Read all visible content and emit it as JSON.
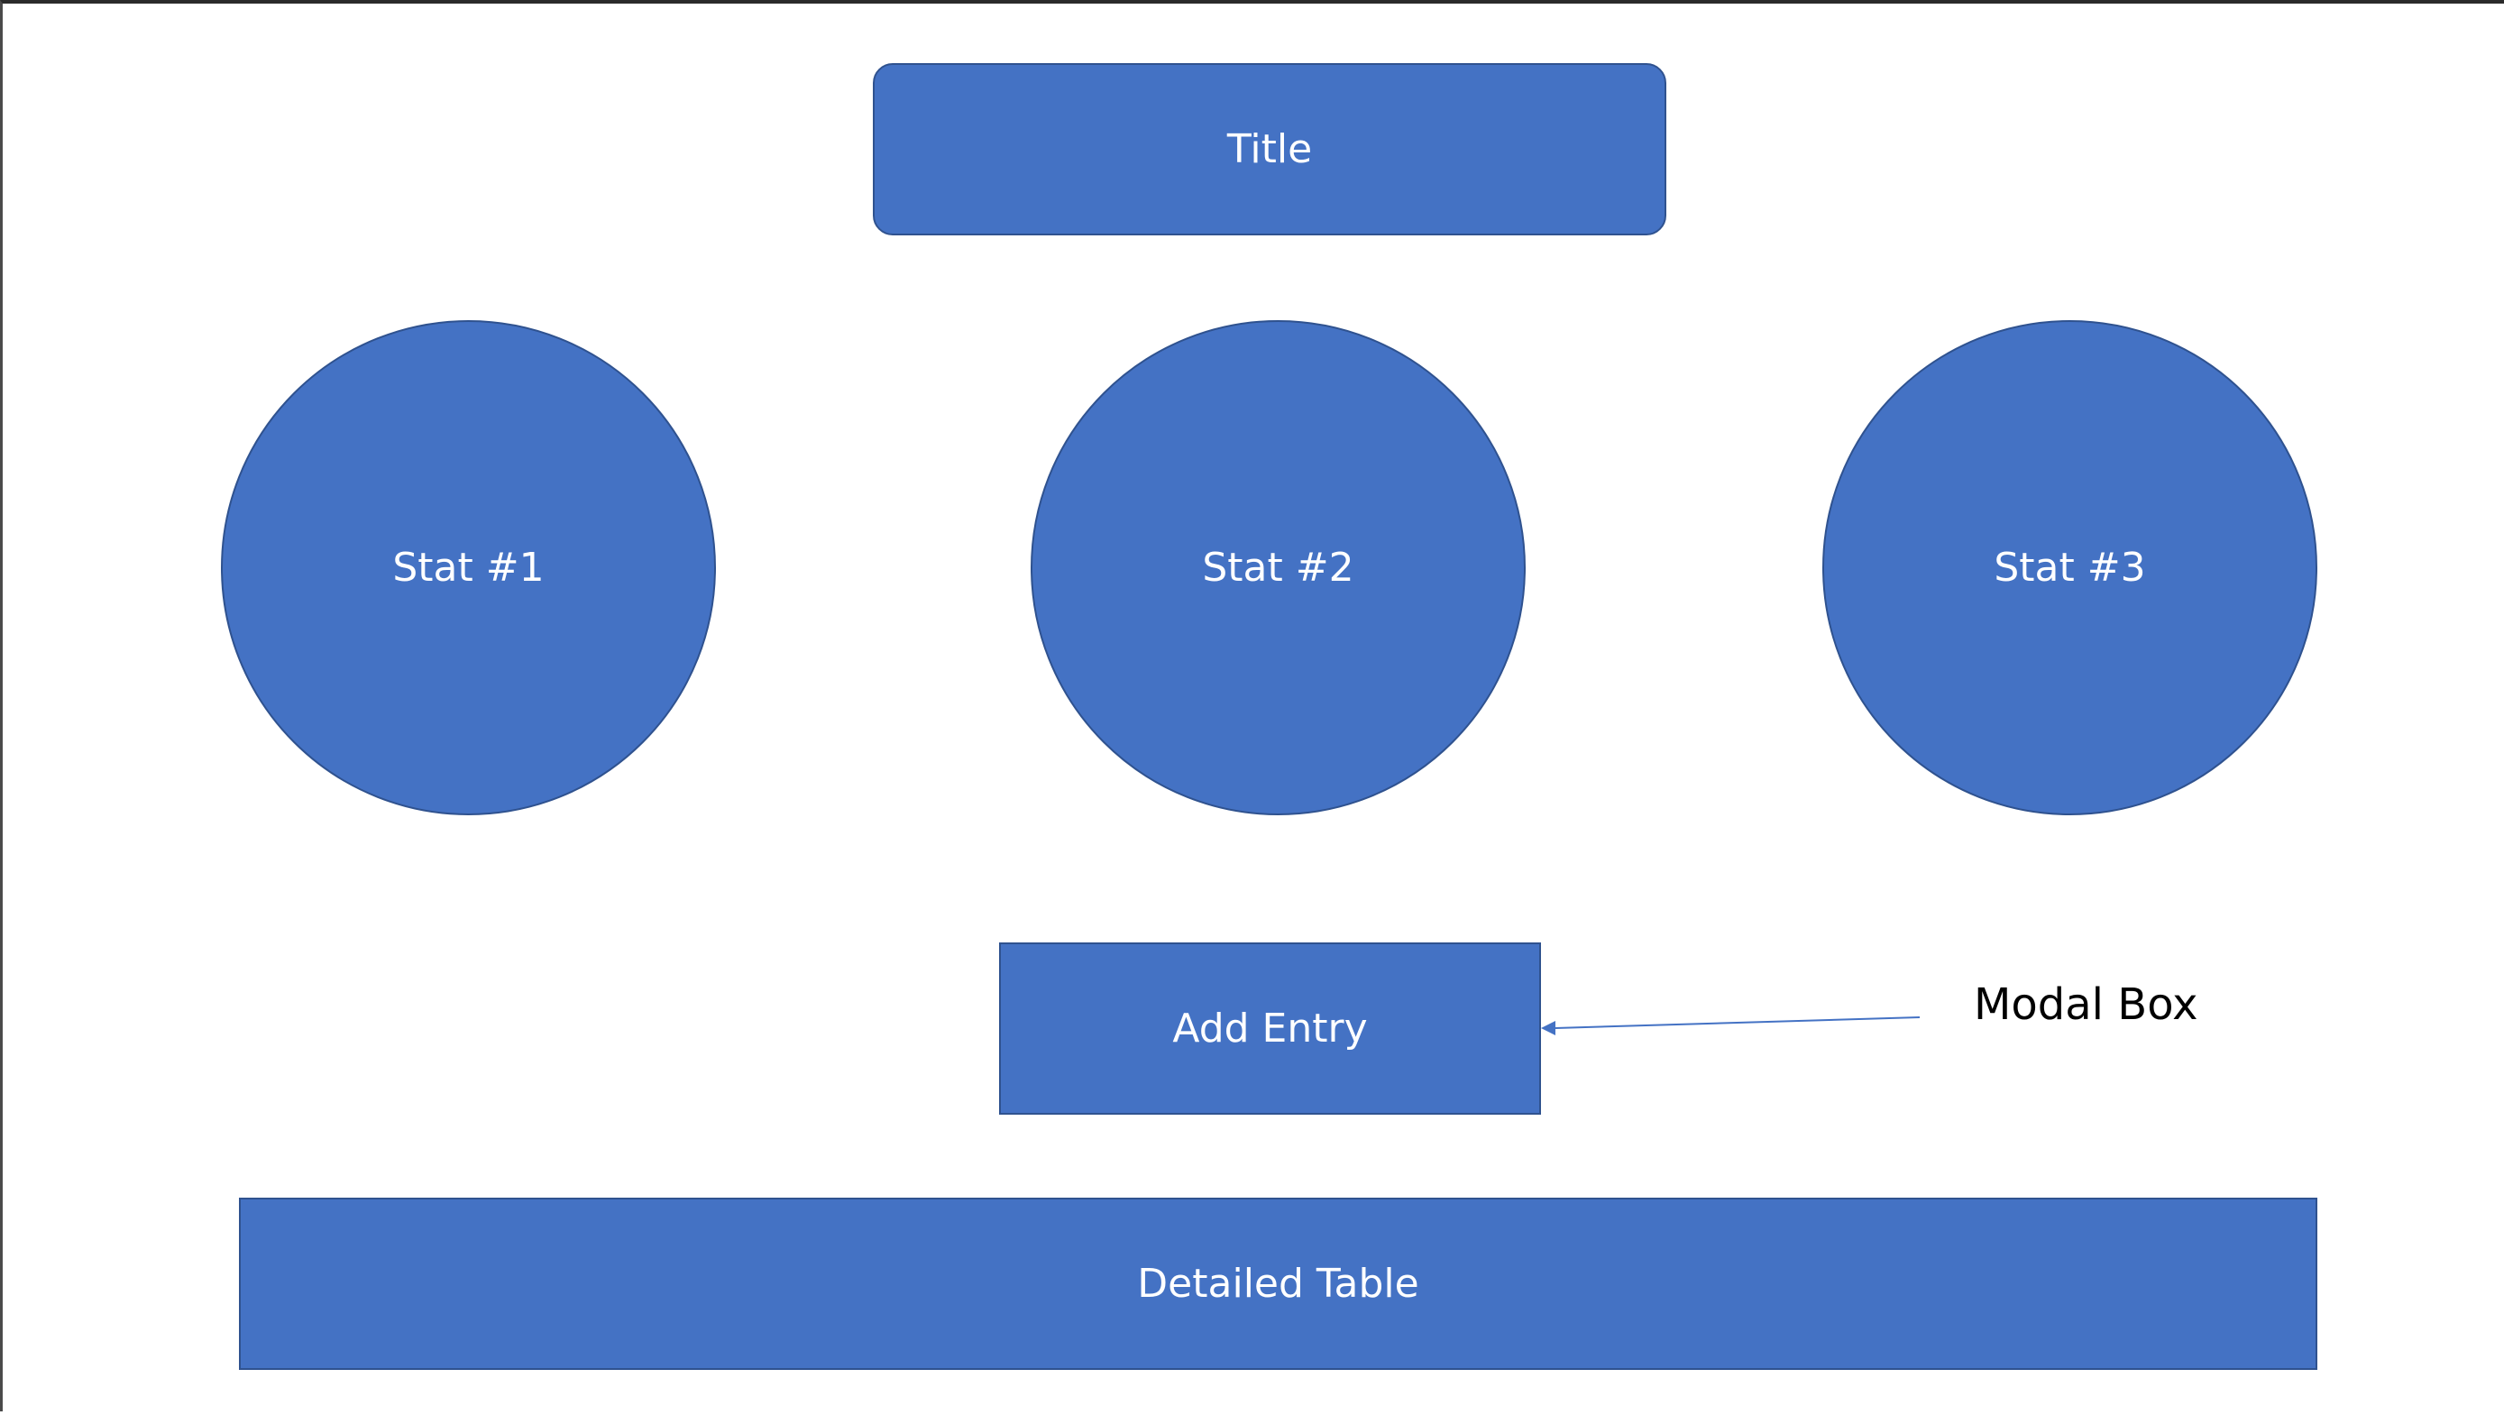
{
  "diagram": {
    "title": {
      "label": "Title"
    },
    "stats": [
      {
        "label": "Stat #1"
      },
      {
        "label": "Stat #2"
      },
      {
        "label": "Stat #3"
      }
    ],
    "add_entry": {
      "label": "Add Entry"
    },
    "detailed_table": {
      "label": "Detailed Table"
    },
    "annotation": {
      "label": "Modal Box"
    }
  },
  "colors": {
    "shape_fill": "#4472c4",
    "shape_border": "#2f528f",
    "connector": "#4472c4",
    "shape_text": "#ffffff",
    "annotation_text": "#000000"
  }
}
